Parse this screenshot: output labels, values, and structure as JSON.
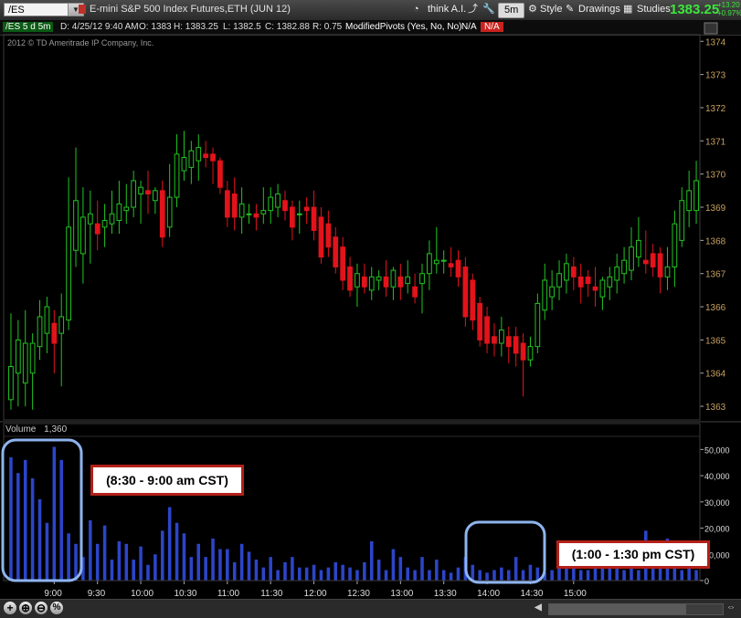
{
  "toolbar": {
    "symbol": "/ES",
    "description": "E-mini S&P 500 Index Futures,ETH (JUN 12)",
    "think_ai": "think A.I.",
    "timeframe": "5m",
    "style": "Style",
    "drawings": "Drawings",
    "studies": "Studies",
    "last_price": "1383.25",
    "change_abs": "+13.20",
    "change_pct": "+0.97%"
  },
  "infobar": {
    "series": "/ES 5 d 5m",
    "date": "D: 4/25/12 9:40 AM",
    "open": "O: 1383",
    "high": "H: 1383.25",
    "low": "L: 1382.5",
    "close": "C: 1382.88",
    "range": "R: 0.75",
    "study": "ModifiedPivots (Yes, No, No)",
    "na1": "N/A",
    "na2": "N/A"
  },
  "copyright": "2012 © TD Ameritrade IP Company, Inc.",
  "volume_label": "Volume",
  "volume_value": "1,360",
  "annotations": {
    "morning": "(8:30 - 9:00 am CST)",
    "afternoon": "(1:00 - 1:30 pm CST)"
  },
  "colors": {
    "up": "#22c422",
    "down": "#e3131b",
    "volume_bar": "#2c45c8",
    "highlight": "#8eb4ee",
    "annotation_border": "#b32019",
    "price_text": "#dddddd"
  },
  "chart_data": [
    {
      "type": "candlestick",
      "title": "/ES 5 d 5m",
      "ylim": [
        1362.7,
        1374.2
      ],
      "yticks": [
        1363,
        1364,
        1365,
        1366,
        1367,
        1368,
        1369,
        1370,
        1371,
        1372,
        1373,
        1374
      ],
      "xticks": [
        "9:00",
        "9:30",
        "10:00",
        "10:30",
        "11:00",
        "11:30",
        "12:00",
        "12:30",
        "13:00",
        "13:30",
        "14:00",
        "14:30",
        "15:00"
      ],
      "bars": [
        {
          "t": "8:30",
          "o": 1363.2,
          "h": 1365.8,
          "l": 1362.9,
          "c": 1364.2
        },
        {
          "t": "8:35",
          "o": 1364.0,
          "h": 1365.6,
          "l": 1363.0,
          "c": 1365.0
        },
        {
          "t": "8:40",
          "o": 1363.7,
          "h": 1365.9,
          "l": 1363.0,
          "c": 1364.9
        },
        {
          "t": "8:45",
          "o": 1364.0,
          "h": 1365.2,
          "l": 1362.9,
          "c": 1364.9
        },
        {
          "t": "8:50",
          "o": 1364.8,
          "h": 1366.2,
          "l": 1364.4,
          "c": 1365.7
        },
        {
          "t": "8:55",
          "o": 1365.2,
          "h": 1366.3,
          "l": 1364.6,
          "c": 1366.0
        },
        {
          "t": "9:00",
          "o": 1365.5,
          "h": 1365.9,
          "l": 1364.0,
          "c": 1364.9
        },
        {
          "t": "9:05",
          "o": 1365.2,
          "h": 1366.4,
          "l": 1363.6,
          "c": 1365.7
        },
        {
          "t": "9:10",
          "o": 1365.6,
          "h": 1369.9,
          "l": 1365.3,
          "c": 1368.4
        },
        {
          "t": "9:15",
          "o": 1367.7,
          "h": 1370.8,
          "l": 1367.2,
          "c": 1369.2
        },
        {
          "t": "9:20",
          "o": 1367.6,
          "h": 1369.6,
          "l": 1366.7,
          "c": 1368.7
        },
        {
          "t": "9:25",
          "o": 1368.5,
          "h": 1369.5,
          "l": 1367.3,
          "c": 1368.8
        },
        {
          "t": "9:30",
          "o": 1368.5,
          "h": 1369.2,
          "l": 1367.7,
          "c": 1368.2
        },
        {
          "t": "9:35",
          "o": 1368.4,
          "h": 1369.1,
          "l": 1367.8,
          "c": 1368.6
        },
        {
          "t": "9:40",
          "o": 1368.5,
          "h": 1369.5,
          "l": 1368.2,
          "c": 1368.8
        },
        {
          "t": "9:45",
          "o": 1368.6,
          "h": 1369.8,
          "l": 1368.2,
          "c": 1369.1
        },
        {
          "t": "9:50",
          "o": 1368.9,
          "h": 1369.7,
          "l": 1368.5,
          "c": 1369.0
        },
        {
          "t": "9:55",
          "o": 1369.0,
          "h": 1370.1,
          "l": 1368.7,
          "c": 1369.8
        },
        {
          "t": "10:00",
          "o": 1369.4,
          "h": 1369.8,
          "l": 1368.5,
          "c": 1369.6
        },
        {
          "t": "10:05",
          "o": 1369.5,
          "h": 1370.1,
          "l": 1368.8,
          "c": 1369.4
        },
        {
          "t": "10:10",
          "o": 1369.2,
          "h": 1369.6,
          "l": 1368.8,
          "c": 1369.5
        },
        {
          "t": "10:15",
          "o": 1369.5,
          "h": 1369.8,
          "l": 1367.8,
          "c": 1368.1
        },
        {
          "t": "10:20",
          "o": 1368.4,
          "h": 1370.3,
          "l": 1368.1,
          "c": 1369.3
        },
        {
          "t": "10:25",
          "o": 1369.3,
          "h": 1371.2,
          "l": 1369.0,
          "c": 1370.6
        },
        {
          "t": "10:30",
          "o": 1370.1,
          "h": 1371.3,
          "l": 1369.8,
          "c": 1370.5
        },
        {
          "t": "10:35",
          "o": 1370.2,
          "h": 1371.0,
          "l": 1369.7,
          "c": 1370.7
        },
        {
          "t": "10:40",
          "o": 1370.4,
          "h": 1371.2,
          "l": 1369.8,
          "c": 1370.8
        },
        {
          "t": "10:45",
          "o": 1370.6,
          "h": 1371.0,
          "l": 1370.2,
          "c": 1370.5
        },
        {
          "t": "10:50",
          "o": 1370.6,
          "h": 1370.8,
          "l": 1369.7,
          "c": 1370.4
        },
        {
          "t": "10:55",
          "o": 1370.4,
          "h": 1370.5,
          "l": 1369.4,
          "c": 1369.6
        },
        {
          "t": "11:00",
          "o": 1369.5,
          "h": 1369.8,
          "l": 1368.4,
          "c": 1368.7
        },
        {
          "t": "11:05",
          "o": 1369.4,
          "h": 1369.9,
          "l": 1368.3,
          "c": 1368.7
        },
        {
          "t": "11:10",
          "o": 1368.7,
          "h": 1369.6,
          "l": 1368.2,
          "c": 1369.1
        },
        {
          "t": "11:15",
          "o": 1368.8,
          "h": 1369.1,
          "l": 1368.5,
          "c": 1368.8
        },
        {
          "t": "11:20",
          "o": 1368.8,
          "h": 1369.1,
          "l": 1368.3,
          "c": 1368.7
        },
        {
          "t": "11:25",
          "o": 1368.8,
          "h": 1369.6,
          "l": 1368.5,
          "c": 1368.9
        },
        {
          "t": "11:30",
          "o": 1368.9,
          "h": 1369.6,
          "l": 1368.5,
          "c": 1369.3
        },
        {
          "t": "11:35",
          "o": 1369.0,
          "h": 1369.7,
          "l": 1368.7,
          "c": 1369.4
        },
        {
          "t": "11:40",
          "o": 1369.2,
          "h": 1369.5,
          "l": 1368.6,
          "c": 1368.9
        },
        {
          "t": "11:45",
          "o": 1369.0,
          "h": 1369.2,
          "l": 1368.0,
          "c": 1368.4
        },
        {
          "t": "11:50",
          "o": 1368.8,
          "h": 1369.2,
          "l": 1368.2,
          "c": 1368.8
        },
        {
          "t": "11:55",
          "o": 1369.0,
          "h": 1369.3,
          "l": 1368.5,
          "c": 1368.9
        },
        {
          "t": "12:00",
          "o": 1369.0,
          "h": 1369.5,
          "l": 1368.0,
          "c": 1368.3
        },
        {
          "t": "12:05",
          "o": 1368.7,
          "h": 1369.0,
          "l": 1367.3,
          "c": 1367.5
        },
        {
          "t": "12:10",
          "o": 1368.5,
          "h": 1368.9,
          "l": 1367.5,
          "c": 1367.8
        },
        {
          "t": "12:15",
          "o": 1368.1,
          "h": 1368.4,
          "l": 1367.0,
          "c": 1367.2
        },
        {
          "t": "12:20",
          "o": 1367.8,
          "h": 1368.1,
          "l": 1366.5,
          "c": 1366.8
        },
        {
          "t": "12:25",
          "o": 1367.2,
          "h": 1367.5,
          "l": 1366.3,
          "c": 1366.5
        },
        {
          "t": "12:30",
          "o": 1366.6,
          "h": 1367.3,
          "l": 1366.0,
          "c": 1367.0
        },
        {
          "t": "12:35",
          "o": 1366.9,
          "h": 1367.3,
          "l": 1366.4,
          "c": 1366.6
        },
        {
          "t": "12:40",
          "o": 1366.5,
          "h": 1367.2,
          "l": 1366.2,
          "c": 1366.9
        },
        {
          "t": "12:45",
          "o": 1366.8,
          "h": 1367.1,
          "l": 1366.5,
          "c": 1366.9
        },
        {
          "t": "12:50",
          "o": 1366.9,
          "h": 1367.4,
          "l": 1366.3,
          "c": 1366.6
        },
        {
          "t": "12:55",
          "o": 1366.6,
          "h": 1367.2,
          "l": 1366.2,
          "c": 1367.1
        },
        {
          "t": "13:00",
          "o": 1366.9,
          "h": 1367.3,
          "l": 1366.2,
          "c": 1366.6
        },
        {
          "t": "13:05",
          "o": 1366.7,
          "h": 1367.4,
          "l": 1366.4,
          "c": 1366.9
        },
        {
          "t": "13:10",
          "o": 1366.6,
          "h": 1367.0,
          "l": 1366.1,
          "c": 1366.3
        },
        {
          "t": "13:15",
          "o": 1366.7,
          "h": 1367.3,
          "l": 1365.8,
          "c": 1367.0
        },
        {
          "t": "13:20",
          "o": 1367.0,
          "h": 1368.0,
          "l": 1366.5,
          "c": 1367.6
        },
        {
          "t": "13:25",
          "o": 1367.3,
          "h": 1368.4,
          "l": 1367.0,
          "c": 1367.4
        },
        {
          "t": "13:30",
          "o": 1367.4,
          "h": 1367.7,
          "l": 1367.0,
          "c": 1367.4
        },
        {
          "t": "13:35",
          "o": 1367.3,
          "h": 1367.8,
          "l": 1366.9,
          "c": 1367.2
        },
        {
          "t": "13:40",
          "o": 1367.4,
          "h": 1367.7,
          "l": 1366.6,
          "c": 1366.9
        },
        {
          "t": "13:45",
          "o": 1367.2,
          "h": 1367.5,
          "l": 1365.4,
          "c": 1365.7
        },
        {
          "t": "13:50",
          "o": 1366.8,
          "h": 1367.0,
          "l": 1365.3,
          "c": 1365.6
        },
        {
          "t": "13:55",
          "o": 1366.1,
          "h": 1366.3,
          "l": 1364.8,
          "c": 1365.0
        },
        {
          "t": "14:00",
          "o": 1365.7,
          "h": 1366.0,
          "l": 1364.6,
          "c": 1364.9
        },
        {
          "t": "14:05",
          "o": 1365.1,
          "h": 1365.5,
          "l": 1364.5,
          "c": 1364.9
        },
        {
          "t": "14:10",
          "o": 1364.9,
          "h": 1365.7,
          "l": 1364.5,
          "c": 1365.3
        },
        {
          "t": "14:15",
          "o": 1365.1,
          "h": 1365.4,
          "l": 1364.3,
          "c": 1364.8
        },
        {
          "t": "14:20",
          "o": 1365.1,
          "h": 1365.4,
          "l": 1364.2,
          "c": 1364.6
        },
        {
          "t": "14:25",
          "o": 1364.9,
          "h": 1365.2,
          "l": 1363.3,
          "c": 1364.4
        },
        {
          "t": "14:30",
          "o": 1364.4,
          "h": 1365.1,
          "l": 1364.2,
          "c": 1364.8
        },
        {
          "t": "14:35",
          "o": 1364.8,
          "h": 1366.4,
          "l": 1364.6,
          "c": 1366.1
        },
        {
          "t": "14:40",
          "o": 1365.9,
          "h": 1367.3,
          "l": 1365.6,
          "c": 1366.8
        },
        {
          "t": "14:45",
          "o": 1366.3,
          "h": 1367.1,
          "l": 1365.9,
          "c": 1366.6
        },
        {
          "t": "14:50",
          "o": 1366.6,
          "h": 1367.4,
          "l": 1366.2,
          "c": 1367.0
        },
        {
          "t": "14:55",
          "o": 1366.8,
          "h": 1367.6,
          "l": 1366.4,
          "c": 1367.3
        },
        {
          "t": "15:00",
          "o": 1367.2,
          "h": 1367.5,
          "l": 1366.5,
          "c": 1366.9
        },
        {
          "t": "15:05",
          "o": 1366.9,
          "h": 1367.3,
          "l": 1366.1,
          "c": 1366.6
        },
        {
          "t": "15:10",
          "o": 1366.9,
          "h": 1367.1,
          "l": 1366.3,
          "c": 1366.7
        },
        {
          "t": "15:15",
          "o": 1366.6,
          "h": 1367.2,
          "l": 1366.0,
          "c": 1366.5
        },
        {
          "t": "15:20",
          "o": 1366.3,
          "h": 1366.9,
          "l": 1365.9,
          "c": 1366.8
        },
        {
          "t": "15:25",
          "o": 1366.6,
          "h": 1367.2,
          "l": 1366.2,
          "c": 1366.9
        },
        {
          "t": "15:30",
          "o": 1366.8,
          "h": 1367.6,
          "l": 1366.4,
          "c": 1367.2
        },
        {
          "t": "15:35",
          "o": 1367.0,
          "h": 1367.8,
          "l": 1366.7,
          "c": 1367.4
        },
        {
          "t": "15:40",
          "o": 1367.1,
          "h": 1368.4,
          "l": 1366.8,
          "c": 1367.8
        },
        {
          "t": "15:45",
          "o": 1367.5,
          "h": 1368.7,
          "l": 1367.2,
          "c": 1368.0
        },
        {
          "t": "15:50",
          "o": 1367.4,
          "h": 1368.3,
          "l": 1367.0,
          "c": 1367.3
        },
        {
          "t": "15:55",
          "o": 1367.6,
          "h": 1367.9,
          "l": 1366.9,
          "c": 1367.2
        },
        {
          "t": "16:00",
          "o": 1367.6,
          "h": 1367.8,
          "l": 1366.4,
          "c": 1366.9
        },
        {
          "t": "16:05",
          "o": 1366.9,
          "h": 1367.8,
          "l": 1366.5,
          "c": 1367.2
        },
        {
          "t": "16:10",
          "o": 1367.2,
          "h": 1368.9,
          "l": 1366.6,
          "c": 1368.5
        },
        {
          "t": "16:15",
          "o": 1368.0,
          "h": 1369.6,
          "l": 1367.8,
          "c": 1369.2
        },
        {
          "t": "16:20",
          "o": 1368.9,
          "h": 1370.1,
          "l": 1368.4,
          "c": 1369.5
        },
        {
          "t": "16:25",
          "o": 1368.9,
          "h": 1370.4,
          "l": 1368.5,
          "c": 1369.8
        }
      ]
    },
    {
      "type": "bar",
      "title": "Volume",
      "ylim": [
        0,
        55000
      ],
      "yticks": [
        0,
        10000,
        20000,
        30000,
        40000,
        50000
      ],
      "ytick_labels": [
        "0",
        "10,000",
        "20,000",
        "30,000",
        "40,000",
        "50,000"
      ],
      "values": [
        47000,
        41000,
        46000,
        39000,
        31000,
        22000,
        51000,
        46000,
        18000,
        14000,
        9000,
        23000,
        14000,
        21000,
        8000,
        15000,
        14000,
        8000,
        13000,
        6000,
        10000,
        19000,
        28000,
        22000,
        18000,
        9000,
        14000,
        9000,
        16000,
        12000,
        12000,
        7000,
        14000,
        11000,
        8000,
        5000,
        9000,
        4000,
        7000,
        9000,
        5000,
        5000,
        6000,
        4000,
        5000,
        7000,
        6000,
        5000,
        4000,
        7000,
        15000,
        8000,
        4000,
        12000,
        9000,
        5000,
        4000,
        9000,
        4000,
        8000,
        4000,
        3000,
        5000,
        9000,
        6000,
        4000,
        3000,
        4000,
        5000,
        4000,
        9000,
        4000,
        6000,
        5000,
        3000,
        4000,
        5000,
        8000,
        5000,
        4000,
        4000,
        12000,
        6000,
        8000,
        5000,
        4000,
        5000,
        4000,
        19000,
        10000,
        7000,
        16000,
        5000,
        4000,
        6000,
        4000
      ]
    }
  ]
}
